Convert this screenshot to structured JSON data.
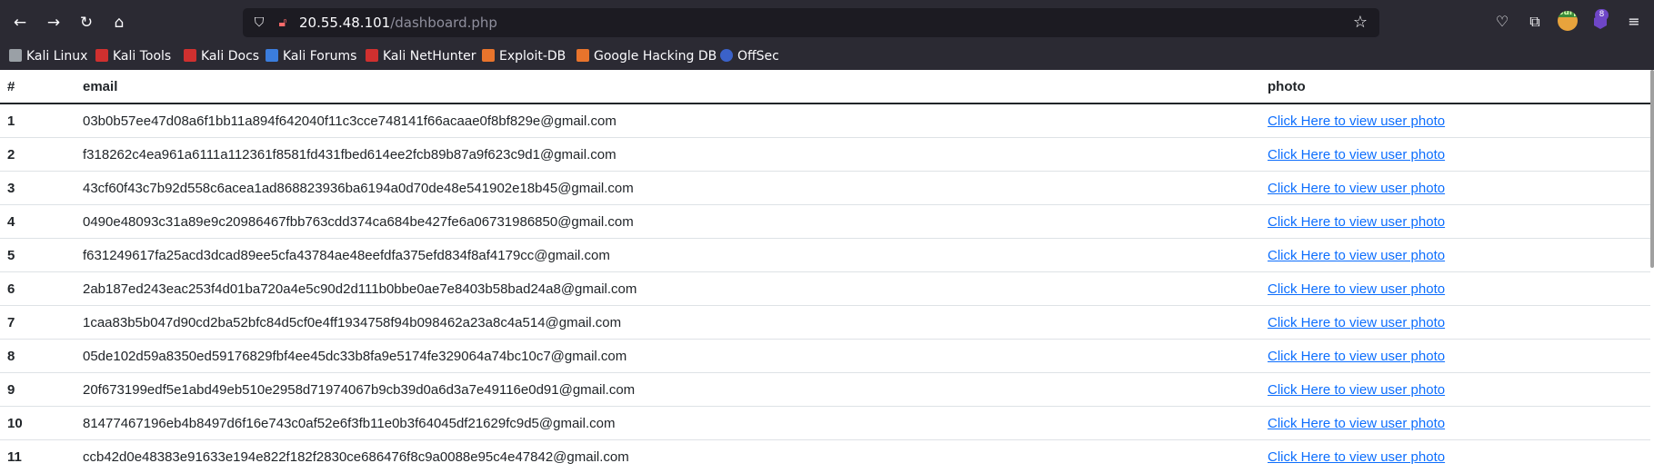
{
  "browser": {
    "url_host": "20.55.48.101",
    "url_path": "/dashboard.php",
    "extension_badge": "8",
    "burp_label": "burp"
  },
  "bookmarks": [
    {
      "label": "Kali Linux",
      "color": "#9aa0a6"
    },
    {
      "label": "Kali Tools",
      "color": "#d0302f"
    },
    {
      "label": "Kali Docs",
      "color": "#d0302f"
    },
    {
      "label": "Kali Forums",
      "color": "#3b7ddd"
    },
    {
      "label": "Kali NetHunter",
      "color": "#d0302f"
    },
    {
      "label": "Exploit-DB",
      "color": "#e8742c"
    },
    {
      "label": "Google Hacking DB",
      "color": "#e8742c"
    },
    {
      "label": "OffSec",
      "color": "#3b62c9"
    }
  ],
  "table": {
    "headers": {
      "id": "#",
      "email": "email",
      "photo": "photo"
    },
    "link_label": "Click Here to view user photo",
    "rows": [
      {
        "id": "1",
        "email": "03b0b57ee47d08a6f1bb11a894f642040f11c3cce748141f66acaae0f8bf829e@gmail.com"
      },
      {
        "id": "2",
        "email": "f318262c4ea961a6111a112361f8581fd431fbed614ee2fcb89b87a9f623c9d1@gmail.com"
      },
      {
        "id": "3",
        "email": "43cf60f43c7b92d558c6acea1ad868823936ba6194a0d70de48e541902e18b45@gmail.com"
      },
      {
        "id": "4",
        "email": "0490e48093c31a89e9c20986467fbb763cdd374ca684be427fe6a06731986850@gmail.com"
      },
      {
        "id": "5",
        "email": "f631249617fa25acd3dcad89ee5cfa43784ae48eefdfa375efd834f8af4179cc@gmail.com"
      },
      {
        "id": "6",
        "email": "2ab187ed243eac253f4d01ba720a4e5c90d2d111b0bbe0ae7e8403b58bad24a8@gmail.com"
      },
      {
        "id": "7",
        "email": "1caa83b5b047d90cd2ba52bfc84d5cf0e4ff1934758f94b098462a23a8c4a514@gmail.com"
      },
      {
        "id": "8",
        "email": "05de102d59a8350ed59176829fbf4ee45dc33b8fa9e5174fe329064a74bc10c7@gmail.com"
      },
      {
        "id": "9",
        "email": "20f673199edf5e1abd49eb510e2958d71974067b9cb39d0a6d3a7e49116e0d91@gmail.com"
      },
      {
        "id": "10",
        "email": "81477467196eb4b8497d6f16e743c0af52e6f3fb11e0b3f64045df21629fc9d5@gmail.com"
      },
      {
        "id": "11",
        "email": "ccb42d0e48383e91633e194e822f182f2830ce686476f8c9a0088e95c4e47842@gmail.com"
      }
    ]
  },
  "colors": {
    "chrome_bg": "#2b2a33",
    "urlbar_bg": "#1c1b22",
    "link": "#0d6efd"
  }
}
